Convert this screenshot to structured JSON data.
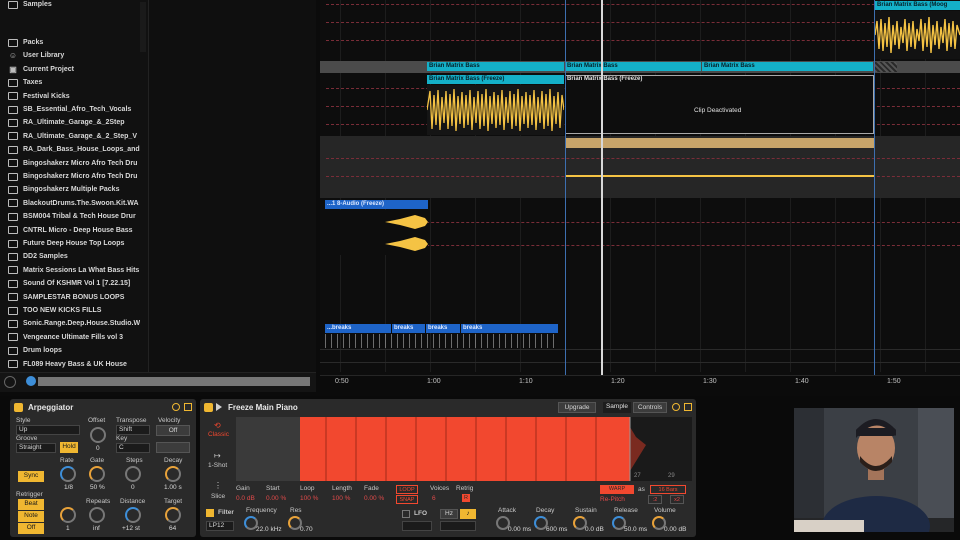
{
  "browser": {
    "top_item": "Samples",
    "items": [
      {
        "label": "Packs",
        "icon": "folder-icon"
      },
      {
        "label": "User Library",
        "icon": "user-icon"
      },
      {
        "label": "Current Project",
        "icon": "project-icon"
      },
      {
        "label": "Taxes",
        "icon": "folder-icon"
      },
      {
        "label": "Festival Kicks",
        "icon": "folder-icon"
      },
      {
        "label": "SB_Essential_Afro_Tech_Vocals",
        "icon": "folder-icon"
      },
      {
        "label": "RA_Ultimate_Garage_&_2Step",
        "icon": "folder-icon"
      },
      {
        "label": "RA_Ultimate_Garage_&_2_Step_V",
        "icon": "folder-icon"
      },
      {
        "label": "RA_Dark_Bass_House_Loops_and",
        "icon": "folder-icon"
      },
      {
        "label": "Bingoshakerz Micro Afro Tech Dru",
        "icon": "folder-icon"
      },
      {
        "label": "Bingoshakerz Micro Afro Tech Dru",
        "icon": "folder-icon"
      },
      {
        "label": "Bingoshakerz Multiple Packs",
        "icon": "folder-icon"
      },
      {
        "label": "BlackoutDrums.The.Swoon.Kit.WA",
        "icon": "folder-icon"
      },
      {
        "label": "BSM004 Tribal & Tech House Drur",
        "icon": "folder-icon"
      },
      {
        "label": "CNTRL Micro - Deep House Bass",
        "icon": "folder-icon"
      },
      {
        "label": "Future Deep House Top Loops",
        "icon": "folder-icon"
      },
      {
        "label": "DD2 Samples",
        "icon": "folder-icon"
      },
      {
        "label": "Matrix Sessions La What Bass Hits",
        "icon": "folder-icon"
      },
      {
        "label": "Sound Of KSHMR Vol 1 [7.22.15]",
        "icon": "folder-icon"
      },
      {
        "label": "SAMPLESTAR BONUS LOOPS",
        "icon": "folder-icon"
      },
      {
        "label": "TOO NEW KICKS FILLS",
        "icon": "folder-icon"
      },
      {
        "label": "Sonic.Range.Deep.House.Studio.W",
        "icon": "folder-icon"
      },
      {
        "label": "Vengeance Ultimate Fills vol 3",
        "icon": "folder-icon"
      },
      {
        "label": "Drum loops",
        "icon": "folder-icon"
      },
      {
        "label": "FL089 Heavy Bass & UK House",
        "icon": "folder-icon"
      }
    ]
  },
  "arrangement": {
    "clips": {
      "moog": "Brian Matrix Bass (Moog",
      "bass1": "Brian Matrix Bass",
      "bass2": "Brian Matrix Bass",
      "bass3": "Brian Matrix Bass",
      "freeze1": "Brian Matrix Bass (Freeze)",
      "freeze2": "Brian Matrix Bass (Freeze)",
      "deactivated": "Clip Deactivated",
      "audio": "...1 8-Audio (Freeze)",
      "breaks1": "...breaks",
      "breaks2": "breaks",
      "breaks3": "breaks",
      "breaks4": "breaks"
    },
    "ruler": [
      "0:50",
      "1:00",
      "1:10",
      "1:20",
      "1:30",
      "1:40",
      "1:50"
    ]
  },
  "arpeggiator": {
    "title": "Arpeggiator",
    "style_label": "Style",
    "style_value": "Up",
    "offset_label": "Offset",
    "offset_value": "0",
    "transpose_label": "Transpose",
    "transpose_value": "Shift",
    "velocity_label": "Velocity",
    "velocity_value": "Off",
    "groove_label": "Groove",
    "groove_value": "Straight",
    "hold_label": "Hold",
    "key_label": "Key",
    "key_value": "C",
    "sync_label": "Sync",
    "rate_label": "Rate",
    "rate_value": "1/8",
    "gate_label": "Gate",
    "gate_value": "50 %",
    "steps_label": "Steps",
    "steps_value": "0",
    "decay_label": "Decay",
    "decay_value": "1.00 s",
    "retrigger_label": "Retrigger",
    "beat_label": "Beat",
    "note_label": "Note",
    "off_label": "Off",
    "repeats_label": "Repeats",
    "repeats_value": "inf",
    "repeats_left_value": "1",
    "distance_label": "Distance",
    "distance_value": "+12 st",
    "target_label": "Target",
    "target_value": "64"
  },
  "sampler": {
    "title": "Freeze Main Piano",
    "upgrade": "Upgrade",
    "tab_sample": "Sample",
    "tab_controls": "Controls",
    "mode_classic": "Classic",
    "mode_oneshot": "1-Shot",
    "mode_slice": "Slice",
    "wave_right_a": "27",
    "wave_right_b": "29",
    "params": [
      {
        "label": "Gain",
        "value": "0.0 dB"
      },
      {
        "label": "Start",
        "value": "0.00 %"
      },
      {
        "label": "Loop",
        "value": "100 %"
      },
      {
        "label": "Length",
        "value": "100 %"
      },
      {
        "label": "Fade",
        "value": "0.00 %"
      }
    ],
    "loop_btn": "LOOP",
    "snap_btn": "SNAP",
    "voices_label": "Voices",
    "voices_value": "6",
    "retrig_label": "Retrig",
    "retrig_value": "R",
    "warp_btn": "WARP",
    "as_label": "as",
    "bars_value": "16 Bars",
    "repitch": "Re-Pitch",
    "half": ":2",
    "double": "x2",
    "filter_label": "Filter",
    "filter_type": "LP12",
    "freq_label": "Frequency",
    "freq_value": "22.0 kHz",
    "res_label": "Res",
    "res_value": "0.70",
    "lfo_label": "LFO",
    "hz_label": "Hz",
    "note_symbol": "♪",
    "attack_label": "Attack",
    "attack_value": "0.00 ms",
    "decay_label": "Decay",
    "decay_value": "600 ms",
    "sustain_label": "Sustain",
    "sustain_value": "0.0 dB",
    "release_label": "Release",
    "release_value": "50.0 ms",
    "volume_label": "Volume",
    "volume_value": "0.00 dB"
  },
  "colors": {
    "clip_cyan": "#14b0c8",
    "audio_yellow": "#f5c344",
    "sampler_wave": "#f2482f",
    "accent_yellow": "#f0b731",
    "blue_clip": "#1e64c8"
  }
}
